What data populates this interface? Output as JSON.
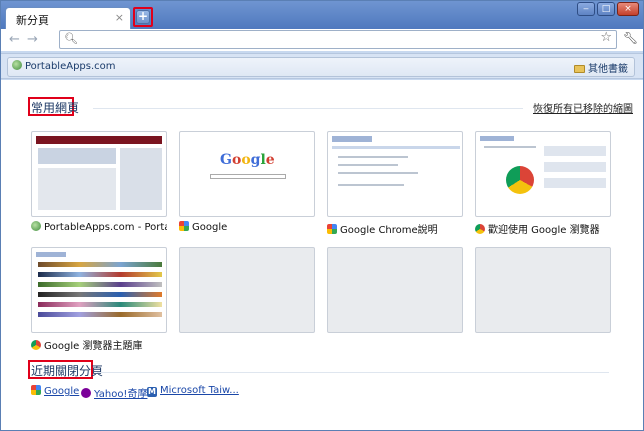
{
  "tab": {
    "title": "新分頁",
    "close_glyph": "×"
  },
  "newtab": {
    "glyph": "+"
  },
  "window_controls": {
    "minimize": "‒",
    "maximize": "□",
    "close": "×"
  },
  "nav": {
    "back": "←",
    "forward": "→"
  },
  "omnibox": {
    "value": "",
    "placeholder": ""
  },
  "bookmarks": {
    "items": [
      {
        "label": "PortableApps.com"
      }
    ],
    "other_label": "其他書籤"
  },
  "most_visited": {
    "title": "常用網頁",
    "restore_link": "恢復所有已移除的縮圖",
    "tiles": [
      {
        "label": "PortableApps.com - Portable ...",
        "icon": "globe-icon"
      },
      {
        "label": "Google",
        "icon": "google-icon"
      },
      {
        "label": "Google Chrome說明",
        "icon": "google-icon"
      },
      {
        "label": "歡迎使用 Google 瀏覽器",
        "icon": "chrome-icon"
      },
      {
        "label": "Google 瀏覽器主題庫",
        "icon": "chrome-icon"
      },
      {
        "label": "",
        "icon": ""
      },
      {
        "label": "",
        "icon": ""
      },
      {
        "label": "",
        "icon": ""
      }
    ]
  },
  "recently_closed": {
    "title": "近期關閉分頁",
    "items": [
      {
        "label": "Google",
        "icon": "google-icon"
      },
      {
        "label": "Yahoo!奇摩",
        "icon": "yahoo-icon"
      },
      {
        "label": "Microsoft Taiw...",
        "icon": "microsoft-icon"
      }
    ]
  },
  "colors": {
    "highlight": "#e0001a",
    "frame": "#4f79be",
    "link": "#1a47a8"
  }
}
